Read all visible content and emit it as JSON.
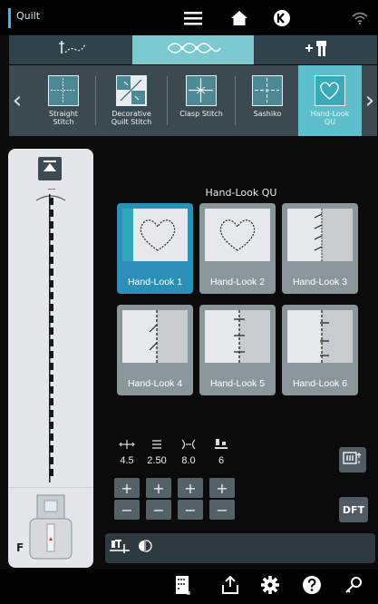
{
  "header": {
    "app_title": "Quilt"
  },
  "tabs": [
    {
      "icon": "needle-curve-icon"
    },
    {
      "icon": "decorative-stitch-icon",
      "selected": true
    },
    {
      "icon": "plus-presser-foot-icon"
    }
  ],
  "stitch_strip": {
    "items": [
      {
        "label": "Straight\nStitch"
      },
      {
        "label": "Decorative\nQuilt Stitch"
      },
      {
        "label": "Clasp Stitch"
      },
      {
        "label": "Sashiko"
      },
      {
        "label": "Hand-Look\nQU",
        "selected": true
      }
    ]
  },
  "left_panel": {
    "foot_letter": "F"
  },
  "grid": {
    "title": "Hand-Look QU",
    "items": [
      {
        "label": "Hand-Look 1",
        "selected": true
      },
      {
        "label": "Hand-Look 2"
      },
      {
        "label": "Hand-Look 3"
      },
      {
        "label": "Hand-Look 4"
      },
      {
        "label": "Hand-Look 5"
      },
      {
        "label": "Hand-Look 6"
      }
    ]
  },
  "params": [
    {
      "icon": "stitch-width-icon",
      "value": "4.5"
    },
    {
      "icon": "stitch-length-icon",
      "value": "2.50"
    },
    {
      "icon": "tension-icon",
      "value": "8.0"
    },
    {
      "icon": "presser-foot-pressure-icon",
      "value": "6"
    }
  ],
  "buttons": {
    "plus": "+",
    "minus": "−",
    "dft": "DFT"
  },
  "colors": {
    "accent": "#3bbfcf",
    "selected_tab": "#7cc9cf",
    "selected_card": "#2c8fb8"
  }
}
